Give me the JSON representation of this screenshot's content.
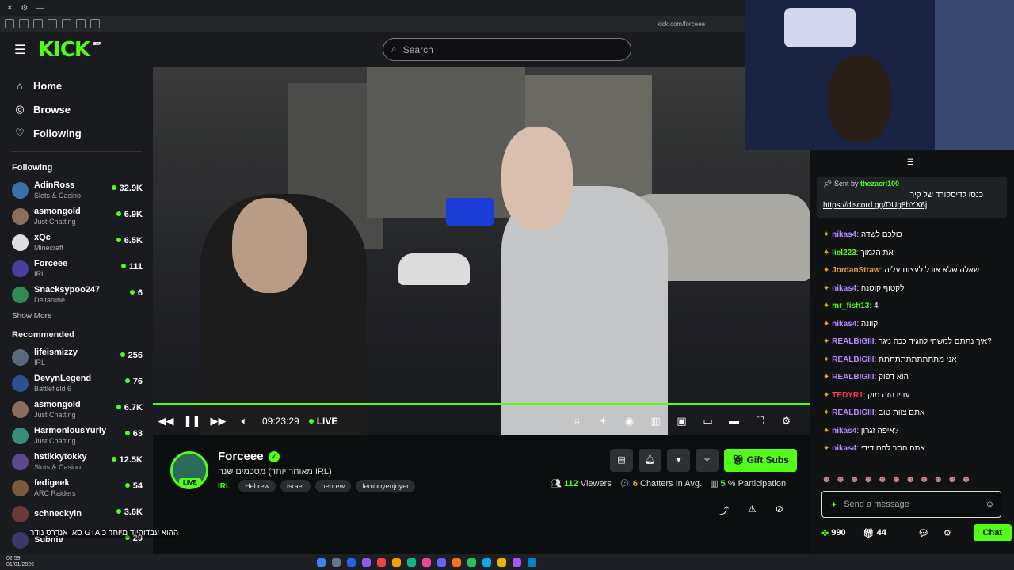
{
  "browser": {
    "url": "kick.com/forceee"
  },
  "header": {
    "logo": "KICK",
    "logo_badge": "BETA",
    "search_placeholder": "Search"
  },
  "nav": [
    {
      "label": "Home",
      "icon": "home-icon"
    },
    {
      "label": "Browse",
      "icon": "compass-icon"
    },
    {
      "label": "Following",
      "icon": "heart-icon"
    }
  ],
  "following": {
    "title": "Following",
    "channels": [
      {
        "name": "AdinRoss",
        "category": "Slots & Casino",
        "viewers": "32.9K",
        "color": "#3a6ea5"
      },
      {
        "name": "asmongold",
        "category": "Just Chatting",
        "viewers": "6.9K",
        "color": "#8b6f5c"
      },
      {
        "name": "xQc",
        "category": "Minecraft",
        "viewers": "6.5K",
        "color": "#dddddd"
      },
      {
        "name": "Forceee",
        "category": "IRL",
        "viewers": "111",
        "color": "#4b3f9e"
      },
      {
        "name": "Snacksypoo247",
        "category": "Deltarune",
        "viewers": "6",
        "color": "#2e8b57"
      }
    ],
    "show_more": "Show More"
  },
  "recommended": {
    "title": "Recommended",
    "channels": [
      {
        "name": "lifeismizzy",
        "category": "IRL",
        "viewers": "256",
        "color": "#5a6a7a"
      },
      {
        "name": "DevynLegend",
        "category": "Battlefield 6",
        "viewers": "76",
        "color": "#2f4f8f"
      },
      {
        "name": "asmongold",
        "category": "Just Chatting",
        "viewers": "6.7K",
        "color": "#8b6f5c"
      },
      {
        "name": "HarmoniousYuriy",
        "category": "Just Chatting",
        "viewers": "63",
        "color": "#3c8c7c"
      },
      {
        "name": "hstikkytokky",
        "category": "Slots & Casino",
        "viewers": "12.5K",
        "color": "#5d4a8a"
      },
      {
        "name": "fedigeek",
        "category": "ARC Raiders",
        "viewers": "54",
        "color": "#7a5a3a"
      },
      {
        "name": "schneckyin",
        "category": "",
        "viewers": "3.6K",
        "color": "#6a3a3a"
      },
      {
        "name": "Subnie",
        "category": "",
        "viewers": "29",
        "color": "#3a3a6a"
      }
    ]
  },
  "player": {
    "time": "09:23:29",
    "live": "LIVE",
    "progress": 1.0
  },
  "stream": {
    "channel": "Forceee",
    "live_badge": "LIVE",
    "title": "מאוחר יותר) מסכמים שנה IRL)",
    "category": "IRL",
    "tags": [
      "Hebrew",
      "israel",
      "hebrew",
      "femboyenjoyer"
    ],
    "gift_label": "Gift Subs",
    "viewers": "112",
    "viewers_label": "Viewers",
    "chatters": "6",
    "chatters_label": "Chatters In Avg.",
    "participation": "5",
    "participation_label": "% Participation"
  },
  "chat": {
    "pinned_by_prefix": "Sent by",
    "pinned_by_user": "thezacri100",
    "pinned_message": "כנסו לדיסקורד של קיר",
    "pinned_link": "https://discord.gg/DUg8hYX6j",
    "messages": [
      {
        "user": "nikas4",
        "text": "כולכם לשדה",
        "color": "#b388ff"
      },
      {
        "user": "liel223",
        "text": "את הגמוך",
        "color": "#53fc18"
      },
      {
        "user": "JordanStraw",
        "text": "שאלה שלא אוכל לעצות עליה",
        "color": "#f0a030"
      },
      {
        "user": "nikas4",
        "text": "לקטוף קוטנה",
        "color": "#b388ff"
      },
      {
        "user": "mr_fish13",
        "text": "4",
        "color": "#53fc18"
      },
      {
        "user": "nikas4",
        "text": "קוונה",
        "color": "#b388ff"
      },
      {
        "user": "REALBIGIII",
        "text": "איך נתתם למשהי להגיד ככה ניגר?",
        "color": "#b388ff"
      },
      {
        "user": "REALBIGIII",
        "text": "אני מתתתתתתתתתתת",
        "color": "#b388ff"
      },
      {
        "user": "REALBIGIII",
        "text": "הוא דפוק",
        "color": "#b388ff"
      },
      {
        "user": "TEDYR1",
        "text": "עדיו הזה מוק",
        "color": "#ff3b5c"
      },
      {
        "user": "REALBIGIII",
        "text": "אתם צוות טוב",
        "color": "#b388ff"
      },
      {
        "user": "nikas4",
        "text": "איפה זגרון?",
        "color": "#b388ff"
      },
      {
        "user": "nikas4",
        "text": "אתה חסר להם דידי",
        "color": "#b388ff"
      }
    ],
    "input_placeholder": "Send a message",
    "points": "990",
    "gifts": "44",
    "chat_button": "Chat"
  },
  "overlay_text": "סאן אנדרס נודר GTAההוא עבדוהיוד מיוחד כן",
  "taskbar": {
    "time": "02:59",
    "date": "01/01/2026"
  }
}
